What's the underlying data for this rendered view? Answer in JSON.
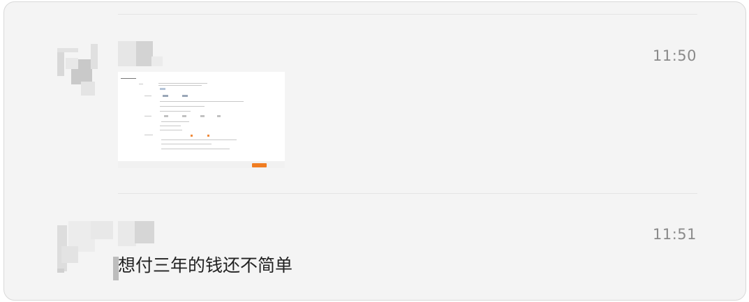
{
  "messages": [
    {
      "time": "11:50",
      "content_type": "image",
      "content_description": "screenshot-thumbnail"
    },
    {
      "time": "11:51",
      "content_type": "text",
      "text": "想付三年的钱还不简单"
    }
  ],
  "colors": {
    "panel_background": "#f4f4f4",
    "time_text": "#8a8a8a",
    "message_text": "#222222",
    "thumbnail_button": "#f07d22"
  }
}
